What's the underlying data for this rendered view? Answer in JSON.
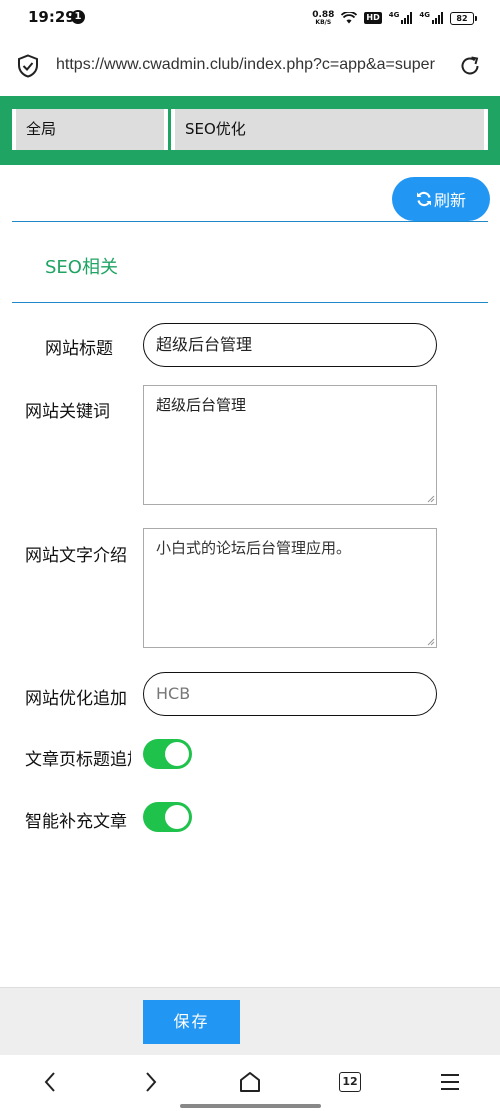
{
  "status": {
    "time": "19:29",
    "notif_count": "1",
    "speed_value": "0.88",
    "speed_unit": "KB/S",
    "hd": "HD",
    "sig1_label": "4G",
    "sig2_label": "4G",
    "battery": "82"
  },
  "browser": {
    "url": "https://www.cwadmin.club/index.php?c=app&a=super",
    "tab_count": "12"
  },
  "tabs": [
    {
      "label": "全局"
    },
    {
      "label": "SEO优化"
    }
  ],
  "toolbar": {
    "refresh_label": "刷新"
  },
  "section": {
    "title": "SEO相关"
  },
  "form": {
    "site_title": {
      "label": "网站标题",
      "value": "超级后台管理"
    },
    "site_keywords": {
      "label": "网站关键词",
      "value": "超级后台管理"
    },
    "site_description": {
      "label": "网站文字介绍",
      "value": "小白式的论坛后台管理应用。"
    },
    "seo_append": {
      "label": "网站优化追加",
      "value": "HCB"
    },
    "article_title_append": {
      "label": "文章页标题追加",
      "enabled": true
    },
    "smart_complete": {
      "label": "智能补充文章",
      "enabled": true
    }
  },
  "footer": {
    "save_label": "保存"
  },
  "colors": {
    "brand_green": "#1fa463",
    "accent_blue": "#2196f3",
    "switch_on": "#1fc24a"
  }
}
